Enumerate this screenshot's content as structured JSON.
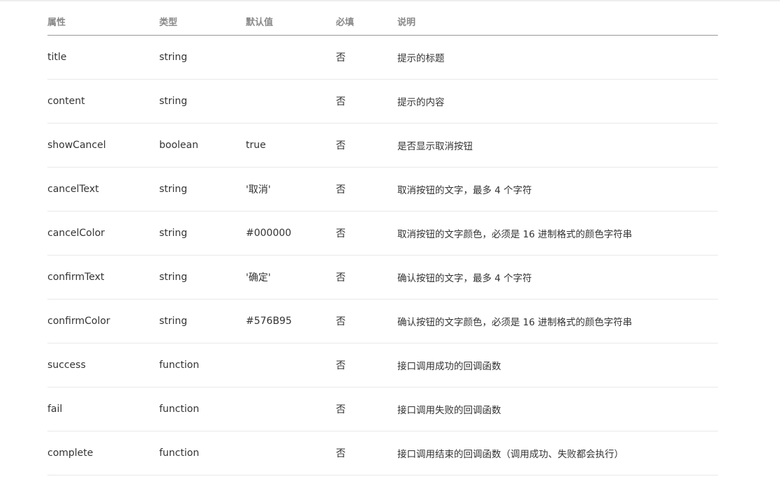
{
  "table": {
    "headers": {
      "property": "属性",
      "type": "类型",
      "default": "默认值",
      "required": "必填",
      "description": "说明"
    },
    "rows": [
      {
        "property": "title",
        "type": "string",
        "default": "",
        "required": "否",
        "description": "提示的标题"
      },
      {
        "property": "content",
        "type": "string",
        "default": "",
        "required": "否",
        "description": "提示的内容"
      },
      {
        "property": "showCancel",
        "type": "boolean",
        "default": "true",
        "required": "否",
        "description": "是否显示取消按钮"
      },
      {
        "property": "cancelText",
        "type": "string",
        "default": "'取消'",
        "required": "否",
        "description": "取消按钮的文字，最多 4 个字符"
      },
      {
        "property": "cancelColor",
        "type": "string",
        "default": "#000000",
        "required": "否",
        "description": "取消按钮的文字颜色，必须是 16 进制格式的颜色字符串"
      },
      {
        "property": "confirmText",
        "type": "string",
        "default": "'确定'",
        "required": "否",
        "description": "确认按钮的文字，最多 4 个字符"
      },
      {
        "property": "confirmColor",
        "type": "string",
        "default": "#576B95",
        "required": "否",
        "description": "确认按钮的文字颜色，必须是 16 进制格式的颜色字符串"
      },
      {
        "property": "success",
        "type": "function",
        "default": "",
        "required": "否",
        "description": "接口调用成功的回调函数"
      },
      {
        "property": "fail",
        "type": "function",
        "default": "",
        "required": "否",
        "description": "接口调用失败的回调函数"
      },
      {
        "property": "complete",
        "type": "function",
        "default": "",
        "required": "否",
        "description": "接口调用结束的回调函数（调用成功、失败都会执行）"
      }
    ]
  }
}
